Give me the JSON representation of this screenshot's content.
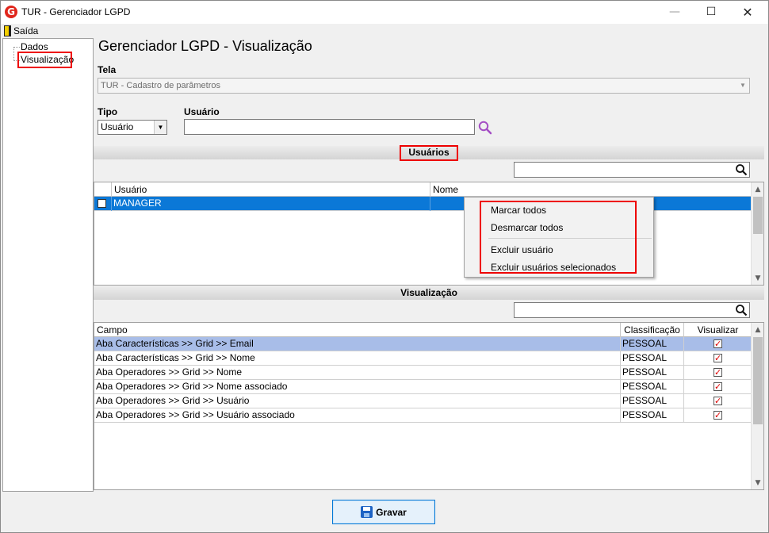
{
  "window": {
    "title": "TUR - Gerenciador LGPD",
    "app_icon_letter": "G",
    "controls": {
      "minimize": "—",
      "maximize": "☐",
      "close": "✕"
    }
  },
  "menubar": {
    "exit_label": "Saída",
    "exit_icon": "exit-door-icon"
  },
  "tree": {
    "items": [
      {
        "label": "Dados"
      },
      {
        "label": "Visualização",
        "highlighted": true
      }
    ]
  },
  "main": {
    "heading": "Gerenciador LGPD - Visualização",
    "tela": {
      "label": "Tela",
      "value": "TUR - Cadastro de parâmetros",
      "disabled": true
    },
    "tipo": {
      "label": "Tipo",
      "value": "Usuário"
    },
    "usuario": {
      "label": "Usuário",
      "value": "",
      "search_icon": "magnifier-icon"
    }
  },
  "users_section": {
    "title": "Usuários",
    "filter_value": "",
    "columns": [
      "",
      "Usuário",
      "Nome"
    ],
    "rows": [
      {
        "checked": false,
        "usuario": "MANAGER",
        "nome": "",
        "selected": true
      }
    ]
  },
  "context_menu": {
    "items": [
      "Marcar todos",
      "Desmarcar todos",
      "Excluir usuário",
      "Excluir usuários selecionados"
    ]
  },
  "visualizacao_section": {
    "title": "Visualização",
    "filter_value": "",
    "columns": [
      "Campo",
      "Classificação",
      "Visualizar"
    ],
    "rows": [
      {
        "campo": "Aba Características >> Grid >> Email",
        "classificacao": "PESSOAL",
        "visualizar": true,
        "selected": true
      },
      {
        "campo": "Aba Características >> Grid >> Nome",
        "classificacao": "PESSOAL",
        "visualizar": true
      },
      {
        "campo": "Aba Operadores >> Grid >> Nome",
        "classificacao": "PESSOAL",
        "visualizar": true
      },
      {
        "campo": "Aba Operadores >> Grid >> Nome associado",
        "classificacao": "PESSOAL",
        "visualizar": true
      },
      {
        "campo": "Aba Operadores >> Grid >> Usuário",
        "classificacao": "PESSOAL",
        "visualizar": true
      },
      {
        "campo": "Aba Operadores >> Grid >> Usuário associado",
        "classificacao": "PESSOAL",
        "visualizar": true
      }
    ]
  },
  "footer": {
    "save_label": "Gravar",
    "save_icon": "floppy-disk-icon"
  },
  "colors": {
    "selection_blue": "#0b78d7",
    "selection_light": "#a8bde8",
    "highlight_red": "#e00000",
    "checkmark_red": "#d00000"
  }
}
